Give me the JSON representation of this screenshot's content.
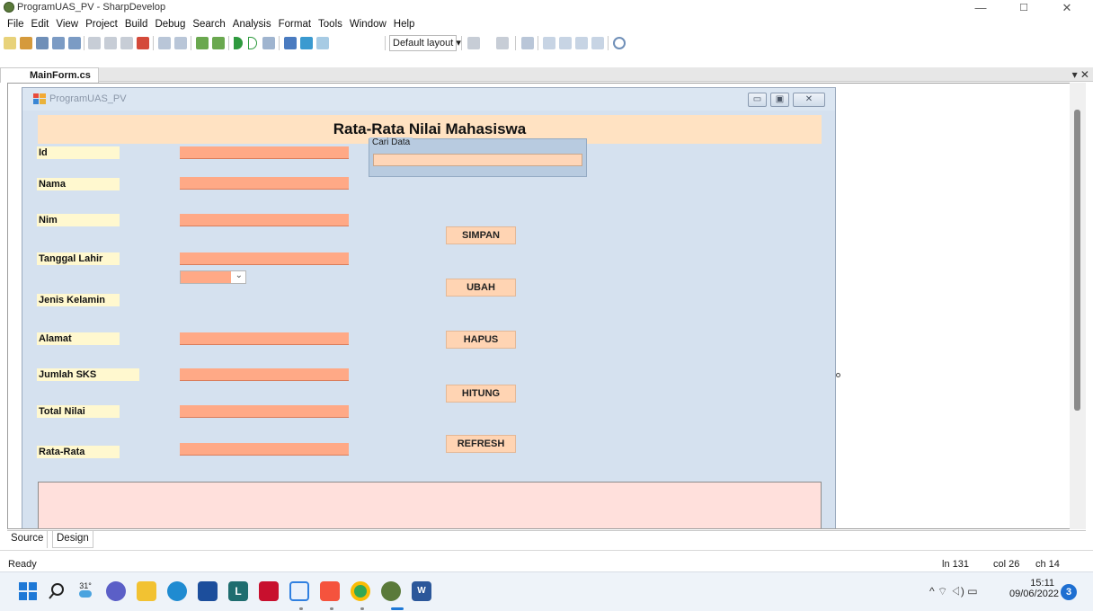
{
  "window": {
    "title": "ProgramUAS_PV - SharpDevelop",
    "minimize": "—",
    "maximize": "☐",
    "close": "✕"
  },
  "menu": [
    "File",
    "Edit",
    "View",
    "Project",
    "Build",
    "Debug",
    "Search",
    "Analysis",
    "Format",
    "Tools",
    "Window",
    "Help"
  ],
  "toolbar": {
    "layout_value": "Default layout ▾"
  },
  "doc_tab": {
    "label": "MainForm.cs",
    "controls": "▾ ✕"
  },
  "form": {
    "title": "ProgramUAS_PV",
    "header": "Rata-Rata Nilai Mahasiswa",
    "labels": {
      "id": "Id",
      "nama": "Nama",
      "nim": "Nim",
      "tanggal_lahir": "Tanggal Lahir",
      "jenis_kelamin": "Jenis Kelamin",
      "alamat": "Alamat",
      "jumlah_sks": "Jumlah SKS",
      "total_nilai": "Total Nilai",
      "rata_rata": "Rata-Rata"
    },
    "search_group": {
      "caption": "Cari Data"
    },
    "buttons": {
      "simpan": "SIMPAN",
      "ubah": "UBAH",
      "hapus": "HAPUS",
      "hitung": "HITUNG",
      "refresh": "REFRESH"
    },
    "controls": {
      "min": "▭",
      "max": "▣",
      "close": "✕"
    }
  },
  "view_tabs": [
    "Source",
    "Design"
  ],
  "status": {
    "ready": "Ready",
    "line": "ln 131",
    "col": "col 26",
    "ch": "ch 14"
  },
  "taskbar": {
    "weather": "31°",
    "time": "15:11",
    "date": "09/06/2022",
    "notifications": "3",
    "tray_icons": "^ ⌔ ◁) ▭"
  },
  "colors": {
    "form_bg": "#d5e1ef",
    "textbox": "#ffa986",
    "label_bg": "#fff8cf",
    "header_band": "#ffe2c2",
    "button": "#ffd4b3",
    "grid": "#ffe0dc"
  }
}
